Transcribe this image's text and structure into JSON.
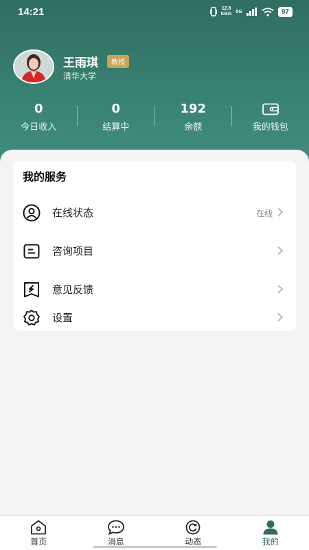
{
  "status_bar": {
    "time": "14:21",
    "net_speed_value": "12.8",
    "net_speed_unit": "KB/s",
    "signal_label": "5G",
    "battery": "97"
  },
  "profile": {
    "name": "王雨琪",
    "badge": "教授",
    "school": "清华大学"
  },
  "stats": [
    {
      "value": "0",
      "label": "今日收入"
    },
    {
      "value": "0",
      "label": "结算中"
    },
    {
      "value": "192",
      "label": "余额"
    },
    {
      "icon": "wallet-icon",
      "label": "我的钱包"
    }
  ],
  "services": {
    "title": "我的服务",
    "items": [
      {
        "icon": "user-circle-icon",
        "label": "在线状态",
        "value": "在线"
      },
      {
        "icon": "document-icon",
        "label": "咨询项目"
      },
      {
        "icon": "feedback-icon",
        "label": "意见反馈"
      },
      {
        "icon": "gear-icon",
        "label": "设置"
      }
    ]
  },
  "bottom_nav": [
    {
      "icon": "home-icon",
      "label": "首页",
      "active": false
    },
    {
      "icon": "chat-bubble-icon",
      "label": "消息",
      "active": false
    },
    {
      "icon": "refresh-circle-icon",
      "label": "动态",
      "active": false
    },
    {
      "icon": "person-icon",
      "label": "我的",
      "active": true
    }
  ],
  "colors": {
    "brand": "#2f6e61",
    "badge": "#c8a45a",
    "background": "#f4f4f4"
  }
}
